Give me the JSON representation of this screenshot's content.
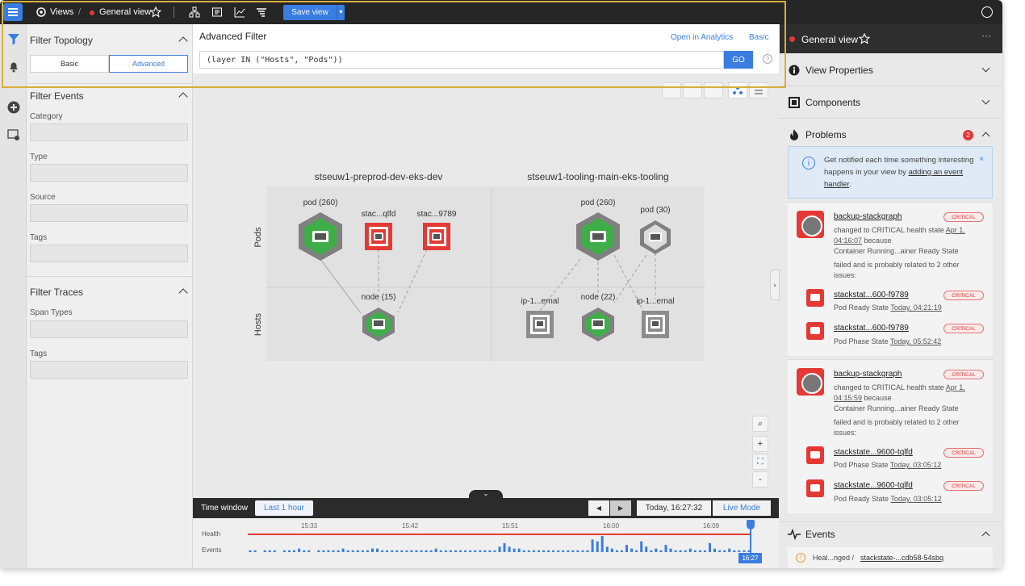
{
  "topbar": {
    "views_label": "Views",
    "separator": "/",
    "view_name": "General view",
    "save_label": "Save view"
  },
  "filter": {
    "topology_title": "Filter Topology",
    "basic_label": "Basic",
    "advanced_label": "Advanced",
    "events_title": "Filter Events",
    "category_label": "Category",
    "type_label": "Type",
    "source_label": "Source",
    "tags_label": "Tags",
    "traces_title": "Filter Traces",
    "span_types_label": "Span Types",
    "traces_tags_label": "Tags"
  },
  "advanced_filter": {
    "title": "Advanced Filter",
    "open_in_analytics": "Open in Analytics",
    "basic_link": "Basic",
    "query": "(layer IN (\"Hosts\", \"Pods\"))",
    "go_label": "GO",
    "help": "?"
  },
  "topology": {
    "layers": [
      "Pods",
      "Hosts"
    ],
    "clusters": [
      {
        "name": "stseuw1-preprod-dev-eks-dev",
        "nodes": [
          {
            "label": "pod (260)",
            "shape": "hexagon",
            "status": "green",
            "layer": "Pods"
          },
          {
            "label": "stac...qlfd",
            "shape": "square",
            "status": "red",
            "layer": "Pods"
          },
          {
            "label": "stac...9789",
            "shape": "square",
            "status": "red",
            "layer": "Pods"
          },
          {
            "label": "node (15)",
            "shape": "hexagon",
            "status": "green",
            "layer": "Hosts"
          }
        ]
      },
      {
        "name": "stseuw1-tooling-main-eks-tooling",
        "nodes": [
          {
            "label": "pod (260)",
            "shape": "hexagon",
            "status": "green",
            "layer": "Pods"
          },
          {
            "label": "pod (30)",
            "shape": "hexagon",
            "status": "gray",
            "layer": "Pods"
          },
          {
            "label": "ip-1...ernal",
            "shape": "square",
            "status": "gray",
            "layer": "Hosts"
          },
          {
            "label": "node (22)",
            "shape": "hexagon",
            "status": "green",
            "layer": "Hosts"
          },
          {
            "label": "ip-1...ernal",
            "shape": "square",
            "status": "gray",
            "layer": "Hosts"
          }
        ]
      }
    ],
    "colors": {
      "green": "#3fae49",
      "red": "#e53935",
      "gray": "#8c8c8c"
    }
  },
  "zoom": {
    "search": "⌕",
    "in": "+",
    "fit": "⛶",
    "out": "-"
  },
  "timewindow": {
    "label": "Time window",
    "range": "Last 1 hour",
    "prev": "◀",
    "next": "▶",
    "time": "Today, 16:27:32",
    "live": "Live Mode"
  },
  "timeline": {
    "health_label": "Health",
    "events_label": "Events",
    "ticks": [
      "15:33",
      "15:42",
      "15:51",
      "16:00",
      "16:09"
    ],
    "current": "16:27",
    "event_counts": [
      1,
      1,
      0,
      1,
      1,
      1,
      0,
      1,
      1,
      1,
      2,
      1,
      1,
      0,
      1,
      1,
      1,
      1,
      1,
      2,
      1,
      1,
      1,
      1,
      1,
      2,
      2,
      1,
      1,
      1,
      1,
      1,
      1,
      1,
      1,
      1,
      1,
      1,
      2,
      1,
      1,
      1,
      1,
      1,
      1,
      1,
      1,
      1,
      1,
      1,
      1,
      3,
      5,
      3,
      2,
      2,
      1,
      1,
      1,
      1,
      1,
      1,
      1,
      1,
      1,
      1,
      1,
      1,
      1,
      1,
      7,
      6,
      9,
      3,
      2,
      1,
      1,
      4,
      2,
      1,
      6,
      3,
      1,
      2,
      1,
      4,
      2,
      1,
      1,
      1,
      2,
      1,
      1,
      1,
      5,
      2,
      1,
      1,
      2,
      1,
      1,
      1,
      1
    ]
  },
  "right": {
    "view_name": "General view",
    "more": "···",
    "view_properties": "View Properties",
    "components": "Components",
    "problems": "Problems",
    "problems_count": "2",
    "notice_text": "Get notified each time something interesting happens in your view by ",
    "notice_link": "adding an event handler",
    "notice_end": ".",
    "notice_close": "×",
    "events": "Events",
    "problem_cards": [
      {
        "title": "backup-stackgraph",
        "badge": "CRITICAL",
        "line1_pre": "changed to CRITICAL health state ",
        "line1_link": "Apr 1, 04:16:07",
        "line1_post": " because",
        "line2": "Container Running...ainer Ready State",
        "line3": "failed and is probably related to 2 other issues:",
        "related": [
          {
            "name": "stackstat...600-f9789",
            "badge": "CRITICAL",
            "check": "Pod Ready State",
            "time": "Today, 04:21:19"
          },
          {
            "name": "stackstat...600-f9789",
            "badge": "CRITICAL",
            "check": "Pod Phase State",
            "time": "Today, 05:52:42"
          }
        ]
      },
      {
        "title": "backup-stackgraph",
        "badge": "CRITICAL",
        "line1_pre": "changed to CRITICAL health state ",
        "line1_link": "Apr 1, 04:15:59",
        "line1_post": " because",
        "line2": "Container Running...ainer Ready State",
        "line3": "failed and is probably related to 2 other issues:",
        "related": [
          {
            "name": "stackstate...9600-tqlfd",
            "badge": "CRITICAL",
            "check": "Pod Phase State",
            "time": "Today, 03:05:12"
          },
          {
            "name": "stackstate...9600-tqlfd",
            "badge": "CRITICAL",
            "check": "Pod Ready State",
            "time": "Today, 03:05:12"
          }
        ]
      }
    ],
    "event_item_pre": "Heal...nged / ",
    "event_item_link": "stackstate-...cdb58-54sbq"
  }
}
